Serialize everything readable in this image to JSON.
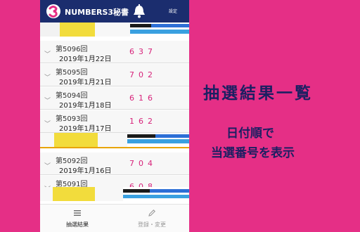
{
  "app": {
    "title": "NUMBERS3秘書",
    "settings_label": "設定"
  },
  "results": [
    {
      "draw": "第5096回",
      "date": "2019年1月22日",
      "numbers": "637"
    },
    {
      "draw": "第5095回",
      "date": "2019年1月21日",
      "numbers": "702"
    },
    {
      "draw": "第5094回",
      "date": "2019年1月18日",
      "numbers": "616"
    },
    {
      "draw": "第5093回",
      "date": "2019年1月17日",
      "numbers": "162"
    },
    {
      "draw": "第5092回",
      "date": "2019年1月16日",
      "numbers": "704"
    },
    {
      "draw": "第5091回",
      "date": "",
      "numbers": "608"
    }
  ],
  "tabs": [
    {
      "label": "抽選結果",
      "icon": "list-icon",
      "active": true
    },
    {
      "label": "登録・変更",
      "icon": "pencil-icon",
      "active": false
    }
  ],
  "caption": {
    "title": "抽選結果一覧",
    "line1": "日付順で",
    "line2": "当選番号を表示"
  },
  "colors": {
    "background": "#e52f86",
    "appbar": "#1b2d6e",
    "numbers": "#d7227a",
    "caption_text": "#1b1f62"
  }
}
